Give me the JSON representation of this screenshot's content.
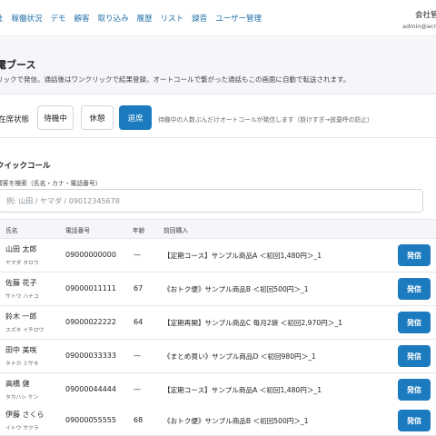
{
  "nav": {
    "items": [
      "社",
      "稼働状況",
      "デモ",
      "顧客",
      "取り込み",
      "履歴",
      "リスト",
      "録音",
      "ユーザー管理"
    ],
    "company": "会社管",
    "admin_email": "admin@acm"
  },
  "header": {
    "title": "電ブース",
    "description": "リックで発信。通話後はワンクリックで結果登録。オートコールで繋がった通話もこの画面に自動で転送されます。"
  },
  "status": {
    "label": "在席状態",
    "buttons": [
      {
        "label": "待機中",
        "active": false
      },
      {
        "label": "休憩",
        "active": false
      },
      {
        "label": "退席",
        "active": true
      }
    ],
    "note": "待機中の人数ぶんだけオートコールが発信します（掛けすぎ→放棄呼の防止）"
  },
  "quick_call": {
    "title": "クイックコール",
    "search_label": "顧客を検索（氏名・カナ・電話番号）",
    "search_placeholder": "例: 山田 / ヤマダ / 09012345678"
  },
  "table": {
    "headers": {
      "name": "氏名",
      "phone": "電話番号",
      "age": "年齢",
      "purchase": "前回購入"
    },
    "call_label": "発信",
    "rows": [
      {
        "name": "山田 太郎",
        "kana": "ヤマダ タロウ",
        "phone": "09000000000",
        "age": "—",
        "purchase": "【定期コース】サンプル商品A ＜初回1,480円＞_1"
      },
      {
        "name": "佐藤 花子",
        "kana": "サトウ ハナコ",
        "phone": "09000011111",
        "age": "67",
        "purchase": "《おトク便》サンプル商品B ＜初回500円＞_1"
      },
      {
        "name": "鈴木 一郎",
        "kana": "スズキ イチロウ",
        "phone": "09000022222",
        "age": "64",
        "purchase": "【定期再開】サンプル商品C 毎月2袋 ＜初回2,970円＞_1"
      },
      {
        "name": "田中 美咲",
        "kana": "タナカ ミサキ",
        "phone": "09000033333",
        "age": "—",
        "purchase": "《まとめ買い》サンプル商品D ＜初回980円＞_1"
      },
      {
        "name": "高橋 健",
        "kana": "タカハシ ケン",
        "phone": "09000044444",
        "age": "—",
        "purchase": "【定期コース】サンプル商品A ＜初回1,480円＞_1"
      },
      {
        "name": "伊藤 さくら",
        "kana": "イトウ サクラ",
        "phone": "09000055555",
        "age": "68",
        "purchase": "《おトク便》サンプル商品B ＜初回500円＞_1"
      }
    ]
  }
}
